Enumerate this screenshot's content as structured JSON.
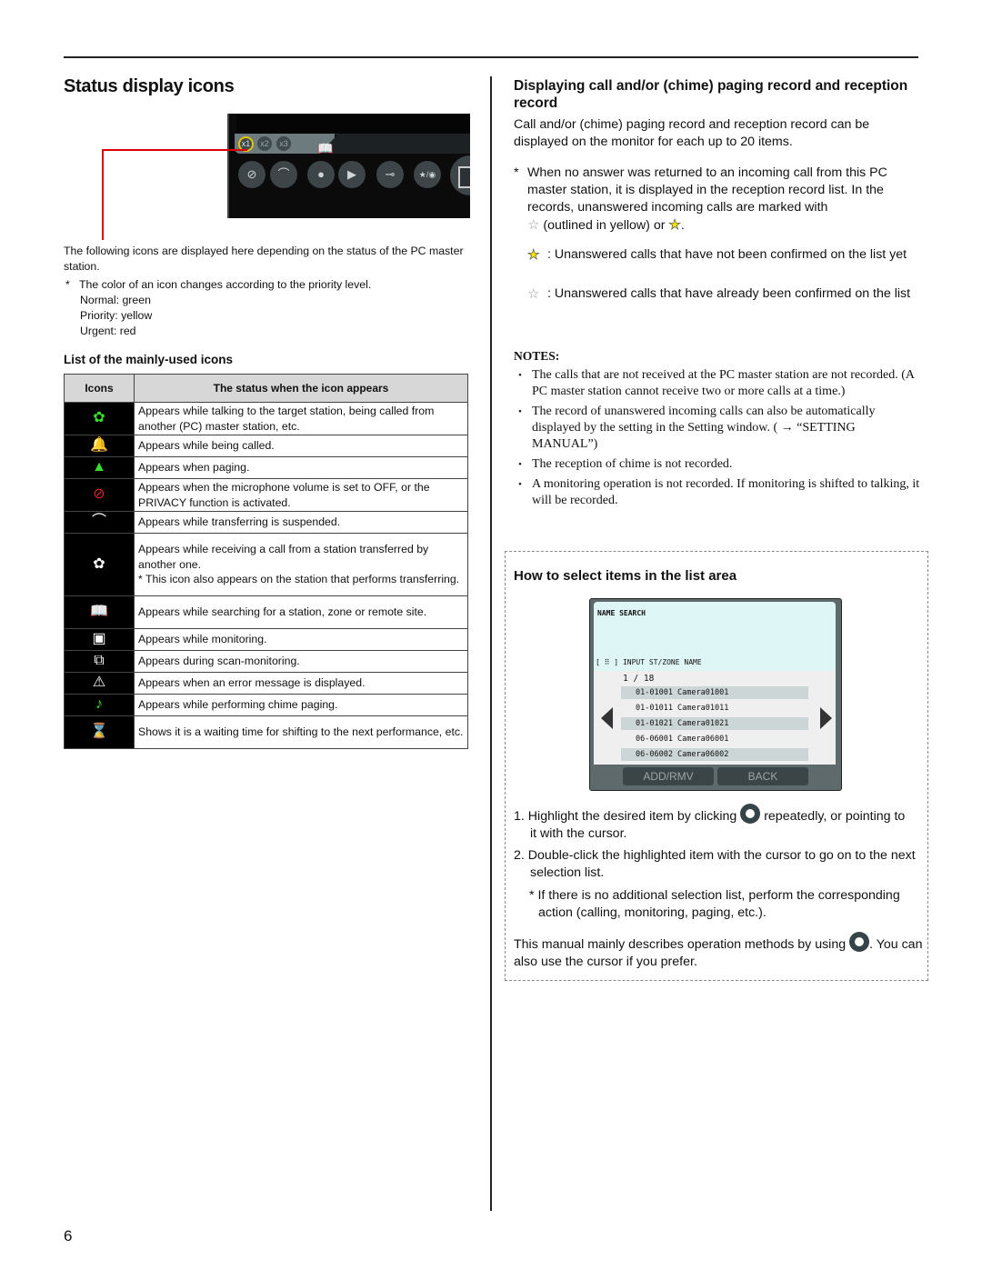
{
  "page_number": "6",
  "left": {
    "title": "Status display icons",
    "toolbar_screenshot": {
      "priority_buttons": [
        "x1",
        "x2",
        "x3"
      ],
      "selected_priority": "x1",
      "buttons": [
        "privacy-icon",
        "transfer-icon",
        "record-icon",
        "play-icon",
        "key-icon",
        "scan-icon",
        "monitor-icon"
      ]
    },
    "intro": "The following icons are displayed here depending on the status of the PC master station.",
    "note_star": "*",
    "note": "The color of an icon changes according to the priority level.",
    "priority_levels": [
      "Normal: green",
      "Priority: yellow",
      "Urgent: red"
    ],
    "list_heading": "List of the mainly-used icons",
    "table": {
      "headers": [
        "Icons",
        "The status when the icon appears"
      ],
      "rows": [
        {
          "icon": "talking-icon",
          "color": "#36e02a",
          "text": "Appears while talking to the target station, being called from another (PC) master station, etc."
        },
        {
          "icon": "bell-icon",
          "color": "#36e02a",
          "text": "Appears while being called."
        },
        {
          "icon": "paging-icon",
          "color": "#36e02a",
          "text": "Appears when paging."
        },
        {
          "icon": "mic-off-icon",
          "color": "#e02020",
          "text": "Appears when the microphone volume is set to OFF, or the PRIVACY function is activated."
        },
        {
          "icon": "transfer-suspended-icon",
          "color": "#ffffff",
          "text": "Appears while transferring is suspended."
        },
        {
          "icon": "transferred-call-icon",
          "color": "#ffffff",
          "text": "Appears while receiving a call from a station transferred by another one.",
          "subnote": "* This icon also appears on the station that performs transferring."
        },
        {
          "icon": "book-search-icon",
          "color": "#ffffff",
          "text": "Appears while searching for a station, zone or remote site."
        },
        {
          "icon": "monitor-icon",
          "color": "#ffffff",
          "text": "Appears while monitoring."
        },
        {
          "icon": "scan-monitor-icon",
          "color": "#ffffff",
          "text": "Appears during scan-monitoring."
        },
        {
          "icon": "warning-icon",
          "color": "#ffffff",
          "text": "Appears when an error message is displayed."
        },
        {
          "icon": "music-note-icon",
          "color": "#36e02a",
          "text": "Appears while performing chime paging."
        },
        {
          "icon": "hourglass-icon",
          "color": "#ffffff",
          "text": "Shows it is a waiting time for shifting to the next performance, etc."
        }
      ]
    }
  },
  "right": {
    "heading": "Displaying call and/or (chime) paging record and reception record",
    "intro": "Call and/or (chime) paging record and reception record can be displayed on the monitor for each up to 20 items.",
    "asterisk_note": "When no answer was returned to an incoming call from this PC master station, it is displayed in the reception record list. In the records, unanswered incoming calls are marked with",
    "asterisk_note_tail_1": "(outlined in yellow) or",
    "asterisk_note_tail_2": ".",
    "legend": [
      {
        "icon": "star-filled-icon",
        "text": ": Unanswered calls that have not been confirmed on the list yet"
      },
      {
        "icon": "star-outline-icon",
        "text": ": Unanswered calls that have already been confirmed on the list"
      }
    ],
    "notes_title": "NOTES:",
    "notes": [
      "The calls that are not received at the PC master station are not recorded. (A PC master station cannot receive two or more calls at a time.)",
      "The record of unanswered incoming calls can also be automatically displayed by the setting in the Setting window. ( → “SETTING MANUAL”)",
      "The reception of chime is not recorded.",
      "A monitoring operation is not recorded. If monitoring is shifted to talking, it will be recorded."
    ],
    "select_heading": "How to select items in the list area",
    "name_search": {
      "title": "NAME SEARCH",
      "input_label": "[ ⠿ ] INPUT ST/ZONE NAME",
      "page": "1 / 18",
      "items": [
        "01-01001 Camera01001",
        "01-01011 Camera01011",
        "01-01021 Camera01021",
        "06-06001 Camera06001",
        "06-06002 Camera06002"
      ],
      "buttons": [
        "ADD/RMV",
        "BACK"
      ]
    },
    "steps": [
      {
        "num": "1.",
        "text_a": "Highlight the desired item by clicking",
        "text_b": "repeatedly, or pointing to it with the cursor."
      },
      {
        "num": "2.",
        "text_a": "Double-click the highlighted item with the cursor to go on to the next selection list."
      }
    ],
    "step_note": "* If there is no additional selection list, perform the corresponding action (calling, monitoring, paging, etc.).",
    "footer_a": "This manual mainly describes operation methods by using",
    "footer_b": ". You can also use the cursor if you prefer."
  }
}
